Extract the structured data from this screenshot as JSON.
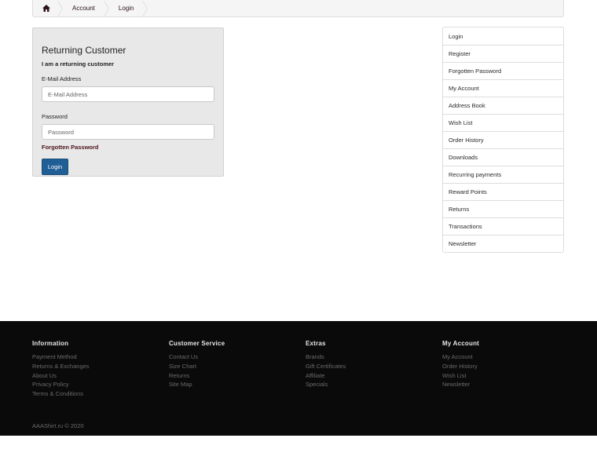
{
  "breadcrumb": {
    "home_icon": "home-icon",
    "items": [
      {
        "label": "Account"
      },
      {
        "label": "Login"
      }
    ]
  },
  "login": {
    "title": "Returning Customer",
    "subtitle": "I am a returning customer",
    "email_label": "E-Mail Address",
    "email_placeholder": "E-Mail Address",
    "password_label": "Password",
    "password_placeholder": "Password",
    "forgotten_link": "Forgotten Password",
    "login_button": "Login"
  },
  "sidebar": {
    "items": [
      {
        "label": "Login"
      },
      {
        "label": "Register"
      },
      {
        "label": "Forgotten Password"
      },
      {
        "label": "My Account"
      },
      {
        "label": "Address Book"
      },
      {
        "label": "Wish List"
      },
      {
        "label": "Order History"
      },
      {
        "label": "Downloads"
      },
      {
        "label": "Recurring payments"
      },
      {
        "label": "Reward Points"
      },
      {
        "label": "Returns"
      },
      {
        "label": "Transactions"
      },
      {
        "label": "Newsletter"
      }
    ]
  },
  "footer": {
    "columns": [
      {
        "title": "Information",
        "links": [
          "Payment Method",
          "Returns & Exchanges",
          "About Us",
          "Privacy Policy",
          "Terms & Conditions"
        ]
      },
      {
        "title": "Customer Service",
        "links": [
          "Contact Us",
          "Size Chart",
          "Returns",
          "Site Map"
        ]
      },
      {
        "title": "Extras",
        "links": [
          "Brands",
          "Gift Certificates",
          "Affiliate",
          "Specials"
        ]
      },
      {
        "title": "My Account",
        "links": [
          "My Account",
          "Order History",
          "Wish List",
          "Newsletter"
        ]
      }
    ],
    "copyright": "AAAShirt.ru © 2020"
  },
  "colors": {
    "accent_button": "#1f5f95",
    "link_dark_red": "#4a1219",
    "footer_bg": "#0a0a0a"
  }
}
